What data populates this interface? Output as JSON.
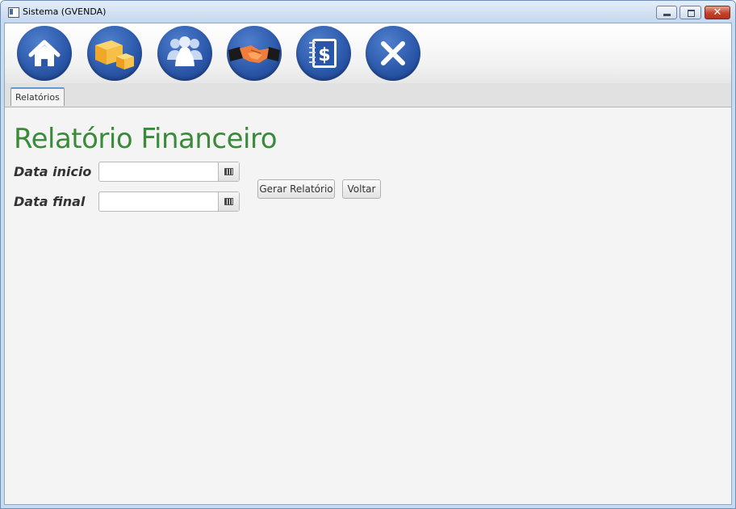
{
  "window": {
    "title": "Sistema (GVENDA)"
  },
  "toolbar": {
    "buttons": [
      {
        "name": "home-icon"
      },
      {
        "name": "boxes-icon"
      },
      {
        "name": "users-icon"
      },
      {
        "name": "handshake-icon"
      },
      {
        "name": "finance-notebook-icon"
      },
      {
        "name": "close-icon"
      }
    ]
  },
  "tabs": [
    {
      "label": "Relatórios",
      "active": true
    }
  ],
  "main": {
    "title": "Relatório Financeiro",
    "start_label": "Data inicio",
    "end_label": "Data final",
    "start_value": "",
    "end_value": "",
    "generate_label": "Gerar Relatório",
    "back_label": "Voltar"
  },
  "colors": {
    "title_green": "#3a8a3a",
    "toolbar_blue": "#2a56a8"
  }
}
